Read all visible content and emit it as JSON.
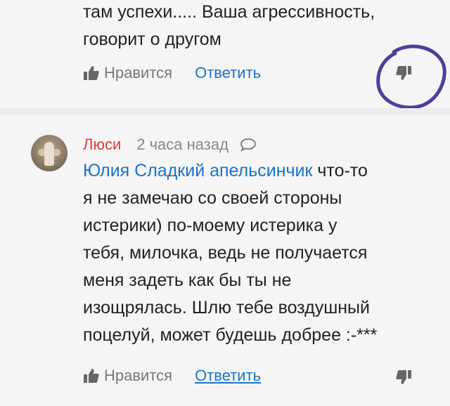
{
  "comment_top": {
    "text_lines": [
      "там успехи..... Ваша агрессивность,",
      "говорит о другом"
    ],
    "like_label": "Нравится",
    "reply_label": "Ответить"
  },
  "comment_bottom": {
    "author": "Люси",
    "time": "2 часа назад",
    "mention": "Юлия Сладкий апельсинчик",
    "text_lines": [
      " что-то",
      "я не замечаю со своей стороны",
      "истерики) по-моему истерика у",
      "тебя, милочка, ведь не получается",
      "меня задеть как бы ты не",
      "изощрялась. Шлю тебе воздушный",
      "поцелуй, может будешь добрее :-***"
    ],
    "like_label": "Нравится",
    "reply_label": "Ответить"
  },
  "colors": {
    "author": "#e53935",
    "link": "#1a73c9",
    "annotation_circle": "#4a3f9c"
  },
  "icons": [
    "thumbs-up-icon",
    "thumbs-down-icon",
    "comment-bubble-icon"
  ]
}
